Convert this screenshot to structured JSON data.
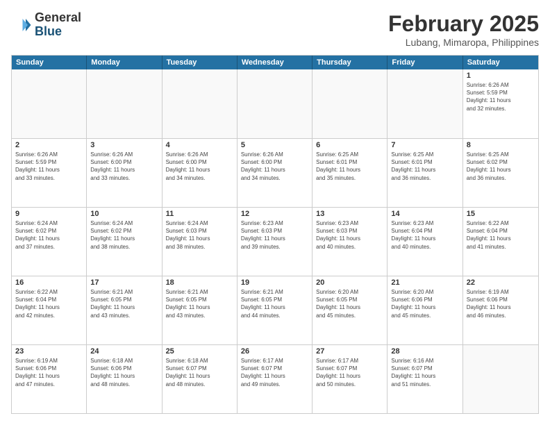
{
  "header": {
    "logo_general": "General",
    "logo_blue": "Blue",
    "title": "February 2025",
    "subtitle": "Lubang, Mimaropa, Philippines"
  },
  "weekdays": [
    "Sunday",
    "Monday",
    "Tuesday",
    "Wednesday",
    "Thursday",
    "Friday",
    "Saturday"
  ],
  "weeks": [
    [
      {
        "day": "",
        "info": ""
      },
      {
        "day": "",
        "info": ""
      },
      {
        "day": "",
        "info": ""
      },
      {
        "day": "",
        "info": ""
      },
      {
        "day": "",
        "info": ""
      },
      {
        "day": "",
        "info": ""
      },
      {
        "day": "1",
        "info": "Sunrise: 6:26 AM\nSunset: 5:59 PM\nDaylight: 11 hours\nand 32 minutes."
      }
    ],
    [
      {
        "day": "2",
        "info": "Sunrise: 6:26 AM\nSunset: 5:59 PM\nDaylight: 11 hours\nand 33 minutes."
      },
      {
        "day": "3",
        "info": "Sunrise: 6:26 AM\nSunset: 6:00 PM\nDaylight: 11 hours\nand 33 minutes."
      },
      {
        "day": "4",
        "info": "Sunrise: 6:26 AM\nSunset: 6:00 PM\nDaylight: 11 hours\nand 34 minutes."
      },
      {
        "day": "5",
        "info": "Sunrise: 6:26 AM\nSunset: 6:00 PM\nDaylight: 11 hours\nand 34 minutes."
      },
      {
        "day": "6",
        "info": "Sunrise: 6:25 AM\nSunset: 6:01 PM\nDaylight: 11 hours\nand 35 minutes."
      },
      {
        "day": "7",
        "info": "Sunrise: 6:25 AM\nSunset: 6:01 PM\nDaylight: 11 hours\nand 36 minutes."
      },
      {
        "day": "8",
        "info": "Sunrise: 6:25 AM\nSunset: 6:02 PM\nDaylight: 11 hours\nand 36 minutes."
      }
    ],
    [
      {
        "day": "9",
        "info": "Sunrise: 6:24 AM\nSunset: 6:02 PM\nDaylight: 11 hours\nand 37 minutes."
      },
      {
        "day": "10",
        "info": "Sunrise: 6:24 AM\nSunset: 6:02 PM\nDaylight: 11 hours\nand 38 minutes."
      },
      {
        "day": "11",
        "info": "Sunrise: 6:24 AM\nSunset: 6:03 PM\nDaylight: 11 hours\nand 38 minutes."
      },
      {
        "day": "12",
        "info": "Sunrise: 6:23 AM\nSunset: 6:03 PM\nDaylight: 11 hours\nand 39 minutes."
      },
      {
        "day": "13",
        "info": "Sunrise: 6:23 AM\nSunset: 6:03 PM\nDaylight: 11 hours\nand 40 minutes."
      },
      {
        "day": "14",
        "info": "Sunrise: 6:23 AM\nSunset: 6:04 PM\nDaylight: 11 hours\nand 40 minutes."
      },
      {
        "day": "15",
        "info": "Sunrise: 6:22 AM\nSunset: 6:04 PM\nDaylight: 11 hours\nand 41 minutes."
      }
    ],
    [
      {
        "day": "16",
        "info": "Sunrise: 6:22 AM\nSunset: 6:04 PM\nDaylight: 11 hours\nand 42 minutes."
      },
      {
        "day": "17",
        "info": "Sunrise: 6:21 AM\nSunset: 6:05 PM\nDaylight: 11 hours\nand 43 minutes."
      },
      {
        "day": "18",
        "info": "Sunrise: 6:21 AM\nSunset: 6:05 PM\nDaylight: 11 hours\nand 43 minutes."
      },
      {
        "day": "19",
        "info": "Sunrise: 6:21 AM\nSunset: 6:05 PM\nDaylight: 11 hours\nand 44 minutes."
      },
      {
        "day": "20",
        "info": "Sunrise: 6:20 AM\nSunset: 6:05 PM\nDaylight: 11 hours\nand 45 minutes."
      },
      {
        "day": "21",
        "info": "Sunrise: 6:20 AM\nSunset: 6:06 PM\nDaylight: 11 hours\nand 45 minutes."
      },
      {
        "day": "22",
        "info": "Sunrise: 6:19 AM\nSunset: 6:06 PM\nDaylight: 11 hours\nand 46 minutes."
      }
    ],
    [
      {
        "day": "23",
        "info": "Sunrise: 6:19 AM\nSunset: 6:06 PM\nDaylight: 11 hours\nand 47 minutes."
      },
      {
        "day": "24",
        "info": "Sunrise: 6:18 AM\nSunset: 6:06 PM\nDaylight: 11 hours\nand 48 minutes."
      },
      {
        "day": "25",
        "info": "Sunrise: 6:18 AM\nSunset: 6:07 PM\nDaylight: 11 hours\nand 48 minutes."
      },
      {
        "day": "26",
        "info": "Sunrise: 6:17 AM\nSunset: 6:07 PM\nDaylight: 11 hours\nand 49 minutes."
      },
      {
        "day": "27",
        "info": "Sunrise: 6:17 AM\nSunset: 6:07 PM\nDaylight: 11 hours\nand 50 minutes."
      },
      {
        "day": "28",
        "info": "Sunrise: 6:16 AM\nSunset: 6:07 PM\nDaylight: 11 hours\nand 51 minutes."
      },
      {
        "day": "",
        "info": ""
      }
    ]
  ]
}
